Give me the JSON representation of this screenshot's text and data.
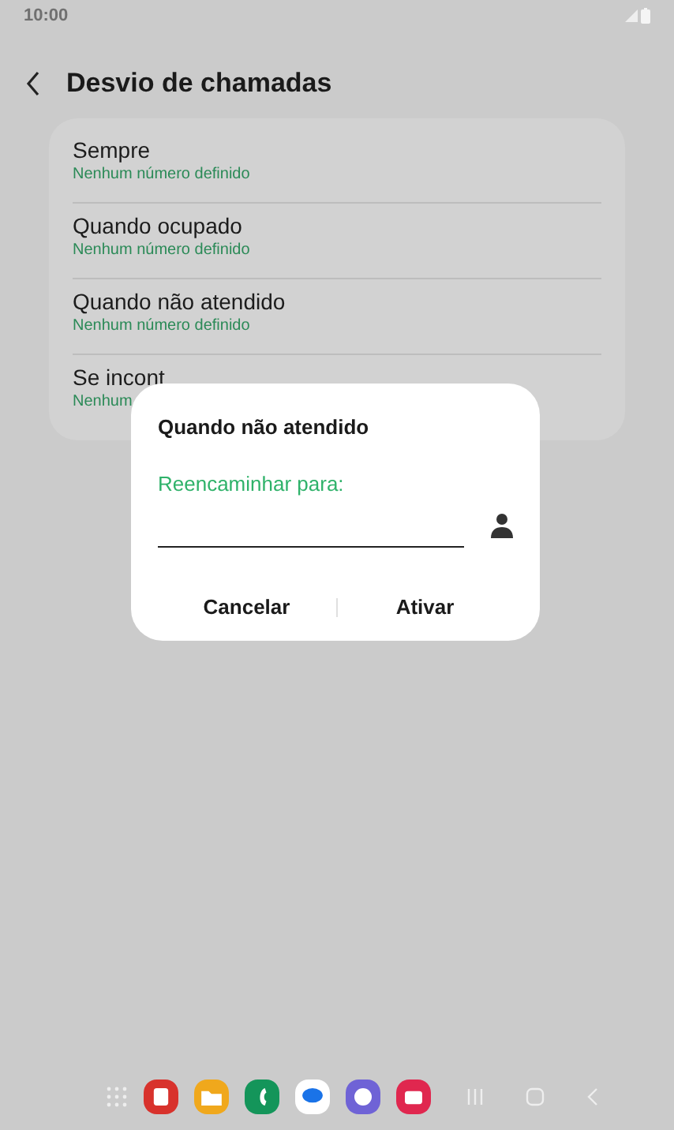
{
  "status_bar": {
    "time": "10:00"
  },
  "header": {
    "title": "Desvio de chamadas"
  },
  "items": [
    {
      "title": "Sempre",
      "subtitle": "Nenhum número definido"
    },
    {
      "title": "Quando ocupado",
      "subtitle": "Nenhum número definido"
    },
    {
      "title": "Quando não atendido",
      "subtitle": "Nenhum número definido"
    },
    {
      "title": "Se incont",
      "subtitle": "Nenhum"
    }
  ],
  "dialog": {
    "title": "Quando não atendido",
    "label": "Reencaminhar para:",
    "buttons": [
      "Cancelar",
      "Ativar"
    ]
  },
  "dock": {
    "apps": [
      {
        "color": "#d8322c"
      },
      {
        "color": "#f0a81c"
      },
      {
        "color": "#14955a"
      },
      {
        "color": "#ffffff"
      },
      {
        "color": "#6f63d6"
      },
      {
        "color": "#e0274f"
      }
    ]
  }
}
